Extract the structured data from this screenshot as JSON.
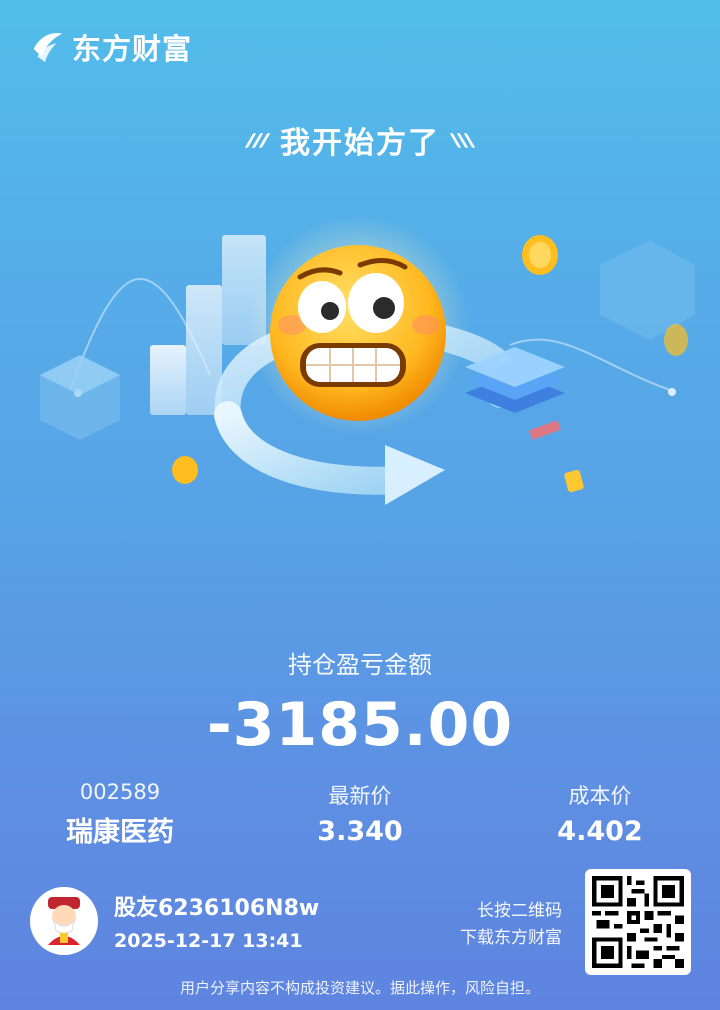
{
  "brand": {
    "name": "东方财富"
  },
  "headline": "我开始方了",
  "stat": {
    "label": "持仓盈亏金额",
    "value": "-3185.00"
  },
  "stock": {
    "code": "002589",
    "name": "瑞康医药"
  },
  "latest_price": {
    "label": "最新价",
    "value": "3.340"
  },
  "cost_price": {
    "label": "成本价",
    "value": "4.402"
  },
  "user": {
    "name": "股友6236106N8w",
    "time": "2025-12-17 13:41"
  },
  "qr_hint": {
    "line1": "长按二维码",
    "line2": "下载东方财富"
  },
  "disclaimer": "用户分享内容不构成投资建议。据此操作，风险自担。",
  "icons": [
    "logo-icon",
    "grimace-emoji-icon",
    "qr-code-icon",
    "avatar-icon"
  ]
}
